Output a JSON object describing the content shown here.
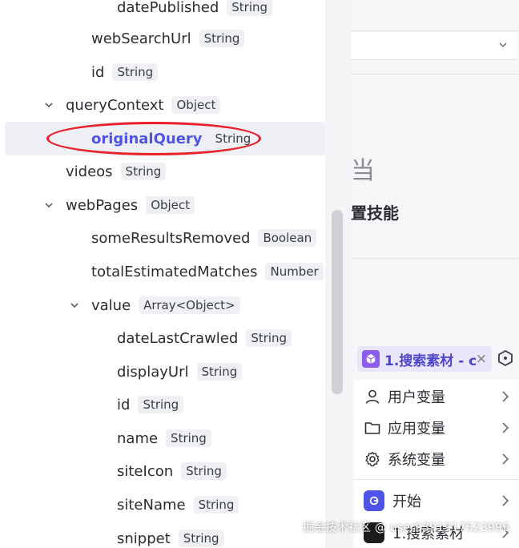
{
  "tree": {
    "rows": [
      {
        "name": "datePublished",
        "type": "String"
      },
      {
        "name": "webSearchUrl",
        "type": "String"
      },
      {
        "name": "id",
        "type": "String"
      },
      {
        "name": "queryContext",
        "type": "Object"
      },
      {
        "name": "originalQuery",
        "type": "String"
      },
      {
        "name": "videos",
        "type": "String"
      },
      {
        "name": "webPages",
        "type": "Object"
      },
      {
        "name": "someResultsRemoved",
        "type": "Boolean"
      },
      {
        "name": "totalEstimatedMatches",
        "type": "Number"
      },
      {
        "name": "value",
        "type": "Array<Object>"
      },
      {
        "name": "dateLastCrawled",
        "type": "String"
      },
      {
        "name": "displayUrl",
        "type": "String"
      },
      {
        "name": "id",
        "type": "String"
      },
      {
        "name": "name",
        "type": "String"
      },
      {
        "name": "siteIcon",
        "type": "String"
      },
      {
        "name": "siteName",
        "type": "String"
      },
      {
        "name": "snippet",
        "type": "String"
      }
    ],
    "selected_row": "originalQuery",
    "highlight_color": "#e8202a",
    "accent_color": "#4e54e6"
  },
  "right_panel": {
    "big_glyph": "当",
    "skill_label": "置技能",
    "tag_label": "1.搜索素材 - c",
    "menu": {
      "items": [
        {
          "label": "用户变量",
          "icon": "user-icon"
        },
        {
          "label": "应用变量",
          "icon": "folder-icon"
        },
        {
          "label": "系统变量",
          "icon": "gear-icon"
        }
      ],
      "nodes": [
        {
          "label": "开始",
          "icon": "start-node-icon",
          "color": "#4e54e6"
        },
        {
          "label": "1.搜索素材",
          "icon": "search-node-icon",
          "color": "#1c1c1e"
        }
      ]
    }
  },
  "watermark": "掘金技术社区 @ user9391917523996"
}
